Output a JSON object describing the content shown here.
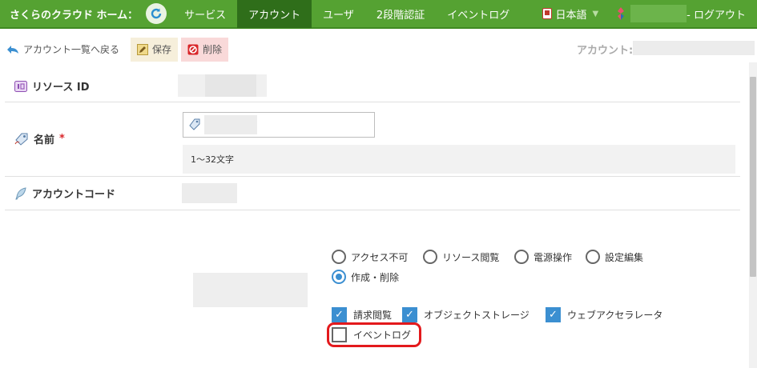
{
  "topbar": {
    "brand": "さくらのクラウド ホーム：",
    "nav": [
      "サービス",
      "アカウント",
      "ユーザ",
      "2段階認証",
      "イベントログ"
    ],
    "active_index": 1,
    "language": "日本語",
    "logout": "- ログアウト"
  },
  "toolbar": {
    "back": "アカウント一覧へ戻る",
    "save": "保存",
    "delete": "削除",
    "account_label": "アカウント:"
  },
  "form": {
    "resource_id_label": "リソース ID",
    "name_label": "名前",
    "required_mark": "*",
    "name_hint": "1〜32文字",
    "account_code_label": "アカウントコード"
  },
  "permissions": {
    "radios": [
      {
        "label": "アクセス不可",
        "selected": false
      },
      {
        "label": "リソース閲覧",
        "selected": false
      },
      {
        "label": "電源操作",
        "selected": false
      },
      {
        "label": "設定編集",
        "selected": false
      },
      {
        "label": "作成・削除",
        "selected": true
      }
    ],
    "checks": [
      {
        "label": "請求閲覧",
        "checked": true
      },
      {
        "label": "オブジェクトストレージ",
        "checked": true
      },
      {
        "label": "ウェブアクセラレータ",
        "checked": true
      },
      {
        "label": "イベントログ",
        "checked": false
      }
    ]
  },
  "colors": {
    "topbar": "#55a232",
    "active_tab": "#2f6e1a",
    "accent_blue": "#3b8fd1",
    "highlight": "#e3191c"
  }
}
